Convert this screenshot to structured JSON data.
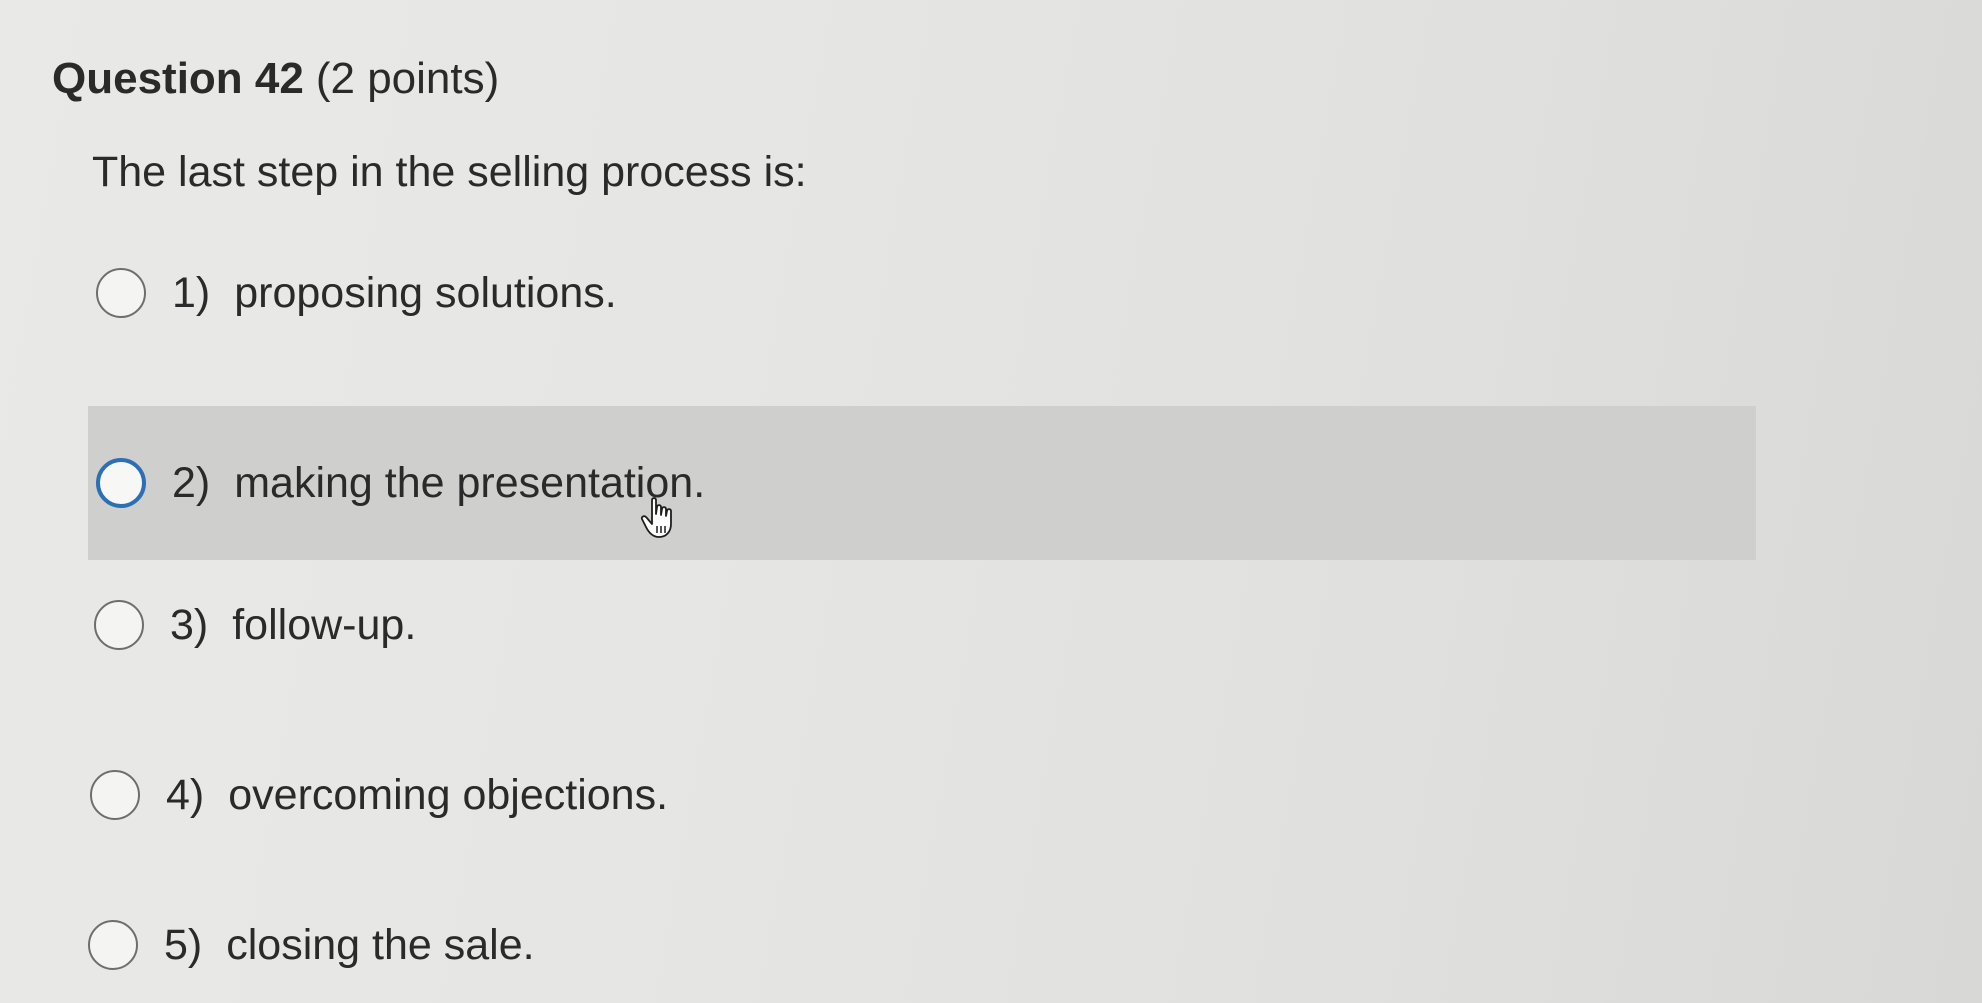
{
  "question": {
    "title": "Question 42",
    "points": "(2 points)",
    "text": "The last step in the selling process is:"
  },
  "options": [
    {
      "number": "1)",
      "label": "proposing solutions.",
      "selected": false,
      "hovered": false
    },
    {
      "number": "2)",
      "label": "making the presentation.",
      "selected": false,
      "hovered": true
    },
    {
      "number": "3)",
      "label": "follow-up.",
      "selected": false,
      "hovered": false
    },
    {
      "number": "4)",
      "label": "overcoming objections.",
      "selected": false,
      "hovered": false
    },
    {
      "number": "5)",
      "label": "closing the sale.",
      "selected": false,
      "hovered": false
    }
  ],
  "colors": {
    "hover_row": "#cfcfcd",
    "focus_ring": "#2b6fb5",
    "text": "#2a2a2a"
  },
  "cursor": {
    "icon": "hand-pointer-icon"
  }
}
